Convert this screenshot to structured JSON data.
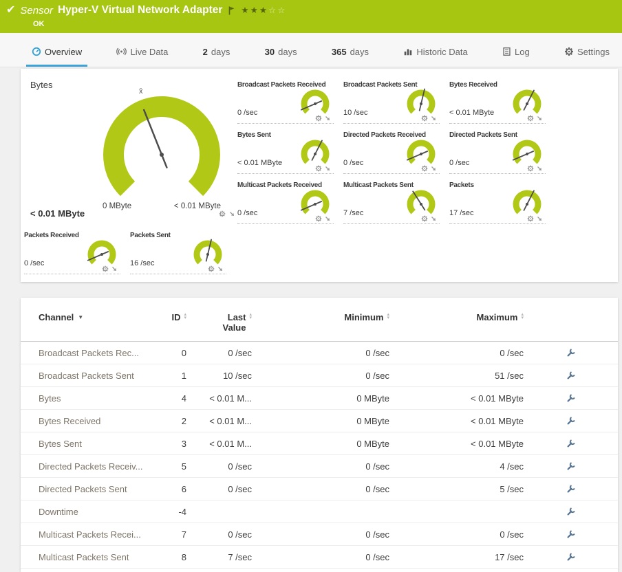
{
  "header": {
    "kind_label": "Sensor",
    "title": "Hyper-V Virtual Network Adapter",
    "status": "OK",
    "rating": {
      "filled": 3,
      "empty": 2
    },
    "bg_color": "#a6c611"
  },
  "tabs": {
    "items": [
      {
        "label": "Overview",
        "icon": "overview-icon",
        "active": true
      },
      {
        "label": "Live Data",
        "icon": "live-data-icon"
      },
      {
        "num": "2",
        "label": "days"
      },
      {
        "num": "30",
        "label": "days"
      },
      {
        "num": "365",
        "label": "days"
      },
      {
        "label": "Historic Data",
        "icon": "historic-data-icon"
      },
      {
        "label": "Log",
        "icon": "log-icon"
      },
      {
        "label": "Settings",
        "icon": "settings-icon"
      }
    ]
  },
  "gauges": {
    "accent_color": "#b1c916",
    "main": {
      "title": "Bytes",
      "value": "< 0.01 MByte",
      "min_label": "0 MByte",
      "max_label": "< 0.01 MByte",
      "mean_marker": "x̄",
      "fraction": 0.42
    },
    "small": [
      {
        "name": "Broadcast Packets Received",
        "value": "0 /sec",
        "fraction": 0.08
      },
      {
        "name": "Broadcast Packets Sent",
        "value": "10 /sec",
        "fraction": 0.55
      },
      {
        "name": "Bytes Received",
        "value": "< 0.01 MByte",
        "fraction": 0.6
      },
      {
        "name": "Bytes Sent",
        "value": "< 0.01 MByte",
        "fraction": 0.6
      },
      {
        "name": "Directed Packets Received",
        "value": "0 /sec",
        "fraction": 0.08
      },
      {
        "name": "Directed Packets Sent",
        "value": "0 /sec",
        "fraction": 0.08
      },
      {
        "name": "Multicast Packets Received",
        "value": "0 /sec",
        "fraction": 0.08
      },
      {
        "name": "Multicast Packets Sent",
        "value": "7 /sec",
        "fraction": 0.38
      },
      {
        "name": "Packets",
        "value": "17 /sec",
        "fraction": 0.6
      },
      {
        "name": "Packets Received",
        "value": "0 /sec",
        "fraction": 0.08
      },
      {
        "name": "Packets Sent",
        "value": "16 /sec",
        "fraction": 0.55
      }
    ]
  },
  "channel_table": {
    "columns": [
      {
        "label": "Channel",
        "sorted": "desc"
      },
      {
        "label": "ID"
      },
      {
        "label": "Last Value"
      },
      {
        "label": "Minimum"
      },
      {
        "label": "Maximum"
      }
    ],
    "rows": [
      {
        "channel": "Broadcast Packets Rec...",
        "id": "0",
        "last": "0 /sec",
        "min": "0 /sec",
        "max": "0 /sec"
      },
      {
        "channel": "Broadcast Packets Sent",
        "id": "1",
        "last": "10 /sec",
        "min": "0 /sec",
        "max": "51 /sec"
      },
      {
        "channel": "Bytes",
        "id": "4",
        "last": "< 0.01 M...",
        "min": "0 MByte",
        "max": "< 0.01 MByte"
      },
      {
        "channel": "Bytes Received",
        "id": "2",
        "last": "< 0.01 M...",
        "min": "0 MByte",
        "max": "< 0.01 MByte"
      },
      {
        "channel": "Bytes Sent",
        "id": "3",
        "last": "< 0.01 M...",
        "min": "0 MByte",
        "max": "< 0.01 MByte"
      },
      {
        "channel": "Directed Packets Receiv...",
        "id": "5",
        "last": "0 /sec",
        "min": "0 /sec",
        "max": "4 /sec"
      },
      {
        "channel": "Directed Packets Sent",
        "id": "6",
        "last": "0 /sec",
        "min": "0 /sec",
        "max": "5 /sec"
      },
      {
        "channel": "Downtime",
        "id": "-4",
        "last": "",
        "min": "",
        "max": ""
      },
      {
        "channel": "Multicast Packets Recei...",
        "id": "7",
        "last": "0 /sec",
        "min": "0 /sec",
        "max": "0 /sec"
      },
      {
        "channel": "Multicast Packets Sent",
        "id": "8",
        "last": "7 /sec",
        "min": "0 /sec",
        "max": "17 /sec"
      }
    ]
  }
}
